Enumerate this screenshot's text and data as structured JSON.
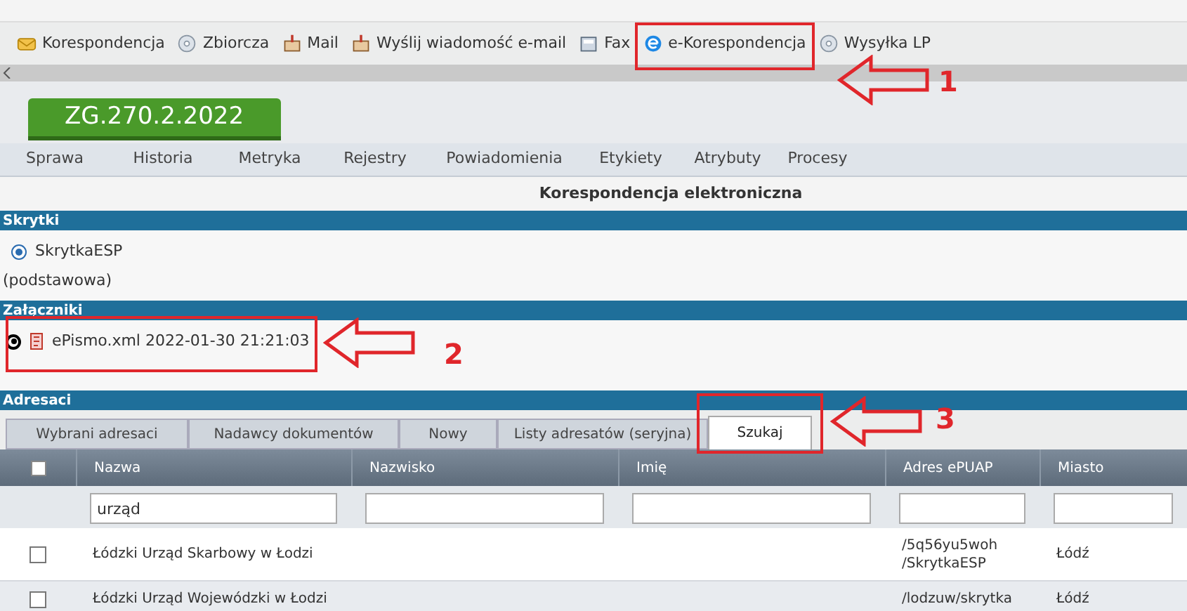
{
  "toolbar": {
    "items": [
      {
        "label": "Korespondencja",
        "kind": "envelope"
      },
      {
        "label": "Zbiorcza",
        "kind": "disc"
      },
      {
        "label": "Mail",
        "kind": "mailbox"
      },
      {
        "label": "Wyślij wiadomość e-mail",
        "kind": "mailbox"
      },
      {
        "label": "Fax",
        "kind": "fax"
      },
      {
        "label": "e-Korespondencja",
        "kind": "globe"
      },
      {
        "label": "Wysyłka LP",
        "kind": "disc"
      }
    ]
  },
  "case_tab": {
    "label": "ZG.270.2.2022"
  },
  "nav": {
    "items": [
      "Sprawa",
      "Historia",
      "Metryka",
      "Rejestry",
      "Powiadomienia",
      "Etykiety",
      "Atrybuty",
      "Procesy"
    ]
  },
  "title": "Korespondencja elektroniczna",
  "skrytki": {
    "heading": "Skrytki",
    "options": [
      {
        "label": "SkrytkaESP",
        "note": "(podstawowa)",
        "selected": true
      }
    ]
  },
  "zalaczniki": {
    "heading": "Załączniki",
    "items": [
      {
        "label": "ePismo.xml 2022-01-30 21:21:03",
        "selected": true
      }
    ]
  },
  "adresaci": {
    "heading": "Adresaci",
    "tabs": [
      {
        "label": "Wybrani adresaci",
        "selected": false
      },
      {
        "label": "Nadawcy dokumentów",
        "selected": false
      },
      {
        "label": "Nowy",
        "selected": false
      },
      {
        "label": "Listy adresatów (seryjna)",
        "selected": false
      },
      {
        "label": "Szukaj",
        "selected": true
      }
    ],
    "table": {
      "all_checked": false,
      "columns": [
        {
          "label": "Nazwa",
          "filter": "urząd"
        },
        {
          "label": "Nazwisko"
        },
        {
          "label": "Imię"
        },
        {
          "label": "Adres ePUAP"
        },
        {
          "label": "Miasto"
        }
      ],
      "rows": [
        {
          "checked": false,
          "cells": [
            "Łódzki Urząd Skarbowy w Łodzi",
            "",
            "",
            "/5q56yu5woh /SkrytkaESP",
            "Łódź"
          ]
        },
        {
          "checked": false,
          "cells": [
            "Łódzki Urząd Wojewódzki w Łodzi",
            "",
            "",
            "/lodzuw/skrytka",
            "Łódź"
          ]
        }
      ]
    }
  },
  "annotations": [
    {
      "label": "1"
    },
    {
      "label": "2"
    },
    {
      "label": "3"
    }
  ]
}
